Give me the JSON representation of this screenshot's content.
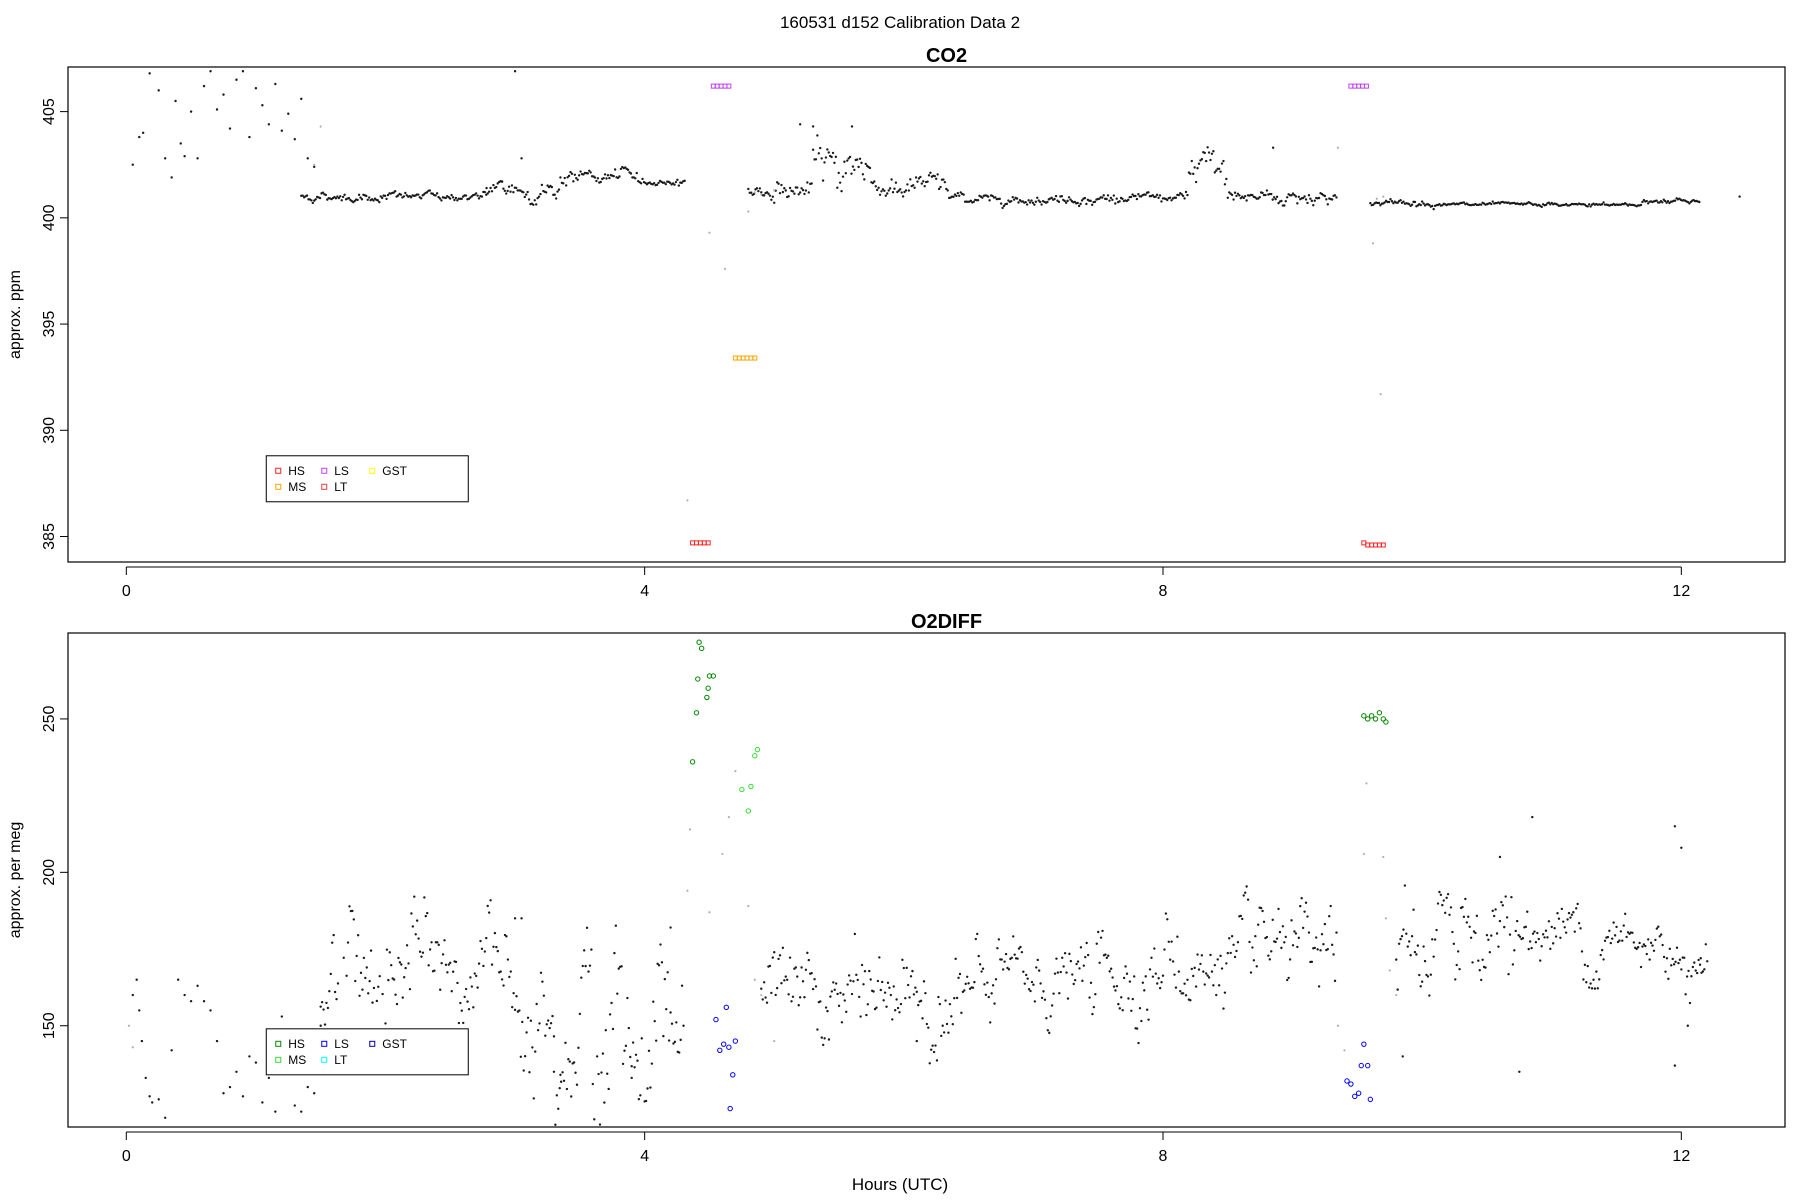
{
  "figure": {
    "suptitle": "160531   d152   Calibration Data 2",
    "xlabel": "Hours (UTC)"
  },
  "colors": {
    "data": "#1a1a1a",
    "data_gray": "#b0b0b0",
    "HS_co2": "#ff2020",
    "MS_co2": "#ffa500",
    "LS_co2": "#c040ff",
    "LT_co2": "#e04040",
    "GST_co2": "#ffff00",
    "HS_o2": "#008800",
    "MS_o2": "#33dd33",
    "LS_o2": "#0000ff",
    "LT_o2": "#00ffff",
    "GST_o2": "#0000aa"
  },
  "chart_data": [
    {
      "type": "scatter",
      "title": "CO2",
      "ylabel": "approx. ppm",
      "xlim": [
        -0.45,
        12.8
      ],
      "ylim": [
        383.8,
        407.1
      ],
      "x_ticks": [
        0,
        4,
        8,
        12
      ],
      "y_ticks": [
        385,
        390,
        395,
        400,
        405
      ],
      "grid": false,
      "legend": {
        "placement": "bottom-left",
        "entries": [
          {
            "label": "HS",
            "color_key": "HS_co2"
          },
          {
            "label": "LS",
            "color_key": "LS_co2"
          },
          {
            "label": "GST",
            "color_key": "GST_co2"
          },
          {
            "label": "MS",
            "color_key": "MS_co2"
          },
          {
            "label": "LT",
            "color_key": "LT_co2"
          }
        ]
      },
      "baseline_series": {
        "name": "data",
        "points": [
          [
            0.05,
            402.5
          ],
          [
            0.1,
            403.8
          ],
          [
            0.13,
            404.0
          ],
          [
            0.18,
            406.8
          ],
          [
            0.25,
            406.0
          ],
          [
            0.3,
            402.8
          ],
          [
            0.35,
            401.9
          ],
          [
            0.38,
            405.5
          ],
          [
            0.42,
            403.5
          ],
          [
            0.45,
            402.9
          ],
          [
            0.5,
            405.0
          ],
          [
            0.55,
            402.8
          ],
          [
            0.6,
            406.2
          ],
          [
            0.65,
            406.9
          ],
          [
            0.7,
            405.1
          ],
          [
            0.75,
            405.8
          ],
          [
            0.8,
            404.2
          ],
          [
            0.85,
            406.5
          ],
          [
            0.9,
            406.9
          ],
          [
            0.95,
            403.8
          ],
          [
            1.0,
            406.1
          ],
          [
            1.05,
            405.3
          ],
          [
            1.1,
            404.4
          ],
          [
            1.15,
            406.3
          ],
          [
            1.2,
            404.1
          ],
          [
            1.25,
            404.9
          ],
          [
            1.3,
            403.7
          ],
          [
            1.35,
            405.6
          ],
          [
            1.4,
            402.8
          ],
          [
            1.45,
            402.4
          ],
          [
            3.0,
            406.9
          ],
          [
            3.05,
            402.8
          ],
          [
            2.78,
            401.4
          ],
          [
            2.9,
            401.7
          ]
        ],
        "segments": [
          {
            "x0": 1.35,
            "x1": 2.8,
            "y": 401.0,
            "noise": 0.12
          },
          {
            "x0": 2.8,
            "x1": 3.35,
            "y": 401.3,
            "noise": 0.25
          },
          {
            "x0": 3.35,
            "x1": 3.95,
            "y": 401.9,
            "noise": 0.18
          },
          {
            "x0": 3.95,
            "x1": 4.32,
            "y": 401.7,
            "noise": 0.08
          },
          {
            "x0": 4.8,
            "x1": 5.3,
            "y": 401.3,
            "noise": 0.25
          },
          {
            "x0": 5.3,
            "x1": 5.75,
            "y": 402.5,
            "noise": 0.55
          },
          {
            "x0": 5.75,
            "x1": 6.35,
            "y": 401.5,
            "noise": 0.3
          },
          {
            "x0": 6.35,
            "x1": 8.2,
            "y": 400.9,
            "noise": 0.12
          },
          {
            "x0": 8.2,
            "x1": 8.5,
            "y": 402.2,
            "noise": 0.6
          },
          {
            "x0": 8.5,
            "x1": 9.35,
            "y": 401.0,
            "noise": 0.2
          },
          {
            "x0": 9.6,
            "x1": 10.1,
            "y": 400.7,
            "noise": 0.08
          },
          {
            "x0": 10.1,
            "x1": 11.7,
            "y": 400.6,
            "noise": 0.05
          },
          {
            "x0": 11.7,
            "x1": 12.15,
            "y": 400.8,
            "noise": 0.08
          }
        ],
        "extra": [
          [
            12.45,
            401.0
          ],
          [
            5.2,
            404.4
          ],
          [
            5.3,
            404.3
          ],
          [
            5.6,
            404.3
          ],
          [
            8.85,
            403.3
          ]
        ]
      },
      "transition_points": [
        [
          4.33,
          386.7
        ],
        [
          4.5,
          399.3
        ],
        [
          4.62,
          397.6
        ],
        [
          4.8,
          400.3
        ],
        [
          4.85,
          401.2
        ],
        [
          4.9,
          401.1
        ],
        [
          5.0,
          401.3
        ],
        [
          9.35,
          403.3
        ],
        [
          9.62,
          398.8
        ],
        [
          9.68,
          391.7
        ],
        [
          9.65,
          400.9
        ],
        [
          9.7,
          401.0
        ],
        [
          1.45,
          402.5
        ],
        [
          1.5,
          404.3
        ]
      ],
      "cal_series": [
        {
          "name": "HS",
          "color_key": "HS_co2",
          "points": [
            [
              4.37,
              384.7
            ],
            [
              4.4,
              384.7
            ],
            [
              4.43,
              384.7
            ],
            [
              4.46,
              384.7
            ],
            [
              4.49,
              384.7
            ],
            [
              9.55,
              384.7
            ],
            [
              9.58,
              384.6
            ],
            [
              9.61,
              384.6
            ],
            [
              9.64,
              384.6
            ],
            [
              9.67,
              384.6
            ],
            [
              9.7,
              384.6
            ]
          ]
        },
        {
          "name": "LS",
          "color_key": "LS_co2",
          "points": [
            [
              4.53,
              406.2
            ],
            [
              4.56,
              406.2
            ],
            [
              4.59,
              406.2
            ],
            [
              4.62,
              406.2
            ],
            [
              4.65,
              406.2
            ],
            [
              9.45,
              406.2
            ],
            [
              9.48,
              406.2
            ],
            [
              9.51,
              406.2
            ],
            [
              9.54,
              406.2
            ],
            [
              9.57,
              406.2
            ]
          ]
        },
        {
          "name": "MS",
          "color_key": "MS_co2",
          "points": [
            [
              4.7,
              393.4
            ],
            [
              4.73,
              393.4
            ],
            [
              4.76,
              393.4
            ],
            [
              4.79,
              393.4
            ],
            [
              4.82,
              393.4
            ],
            [
              4.85,
              393.4
            ]
          ]
        }
      ]
    },
    {
      "type": "scatter",
      "title": "O2DIFF",
      "ylabel": "approx. per meg",
      "xlim": [
        -0.45,
        12.8
      ],
      "ylim": [
        117,
        278
      ],
      "x_ticks": [
        0,
        4,
        8,
        12
      ],
      "y_ticks": [
        150,
        200,
        250
      ],
      "grid": false,
      "legend": {
        "placement": "bottom-left",
        "entries": [
          {
            "label": "HS",
            "color_key": "HS_o2"
          },
          {
            "label": "LS",
            "color_key": "LS_o2"
          },
          {
            "label": "GST",
            "color_key": "GST_o2"
          },
          {
            "label": "MS",
            "color_key": "MS_o2"
          },
          {
            "label": "LT",
            "color_key": "LT_o2"
          }
        ]
      },
      "baseline_series": {
        "name": "data",
        "points": [
          [
            0.05,
            160
          ],
          [
            0.08,
            165
          ],
          [
            0.1,
            155
          ],
          [
            0.12,
            145
          ],
          [
            0.15,
            133
          ],
          [
            0.18,
            127
          ],
          [
            0.2,
            125
          ],
          [
            0.25,
            126
          ],
          [
            0.3,
            120
          ],
          [
            0.35,
            142
          ],
          [
            0.4,
            165
          ],
          [
            0.45,
            160
          ],
          [
            0.5,
            158
          ],
          [
            0.55,
            163
          ],
          [
            0.6,
            158
          ],
          [
            0.65,
            155
          ],
          [
            0.7,
            145
          ],
          [
            0.75,
            128
          ],
          [
            0.8,
            130
          ],
          [
            0.85,
            135
          ],
          [
            0.9,
            127
          ],
          [
            0.95,
            140
          ],
          [
            1.0,
            138
          ],
          [
            1.05,
            125
          ],
          [
            1.1,
            133
          ],
          [
            1.15,
            122
          ],
          [
            1.2,
            153
          ],
          [
            1.25,
            148
          ],
          [
            1.3,
            124
          ],
          [
            1.35,
            122
          ],
          [
            1.4,
            130
          ],
          [
            1.45,
            128
          ],
          [
            1.5,
            150
          ],
          [
            3.0,
            185
          ],
          [
            3.05,
            185
          ],
          [
            3.3,
            135
          ],
          [
            3.35,
            134
          ],
          [
            4.2,
            182
          ],
          [
            4.3,
            150
          ],
          [
            10.85,
            218
          ],
          [
            10.6,
            205
          ],
          [
            11.95,
            215
          ],
          [
            12.0,
            208
          ],
          [
            11.95,
            137
          ],
          [
            12.05,
            150
          ],
          [
            10.75,
            135
          ],
          [
            9.85,
            140
          ]
        ],
        "segments": [
          {
            "x0": 1.5,
            "x1": 2.0,
            "y": 165,
            "noise": 12
          },
          {
            "x0": 2.0,
            "x1": 3.0,
            "y": 168,
            "noise": 10
          },
          {
            "x0": 3.0,
            "x1": 3.6,
            "y": 160,
            "noise": 12
          },
          {
            "x0": 3.6,
            "x1": 4.1,
            "y": 148,
            "noise": 14
          },
          {
            "x0": 4.1,
            "x1": 4.3,
            "y": 160,
            "noise": 12
          },
          {
            "x0": 4.9,
            "x1": 5.6,
            "y": 158,
            "noise": 8
          },
          {
            "x0": 5.6,
            "x1": 6.6,
            "y": 160,
            "noise": 8
          },
          {
            "x0": 6.6,
            "x1": 7.6,
            "y": 165,
            "noise": 7
          },
          {
            "x0": 7.6,
            "x1": 8.5,
            "y": 168,
            "noise": 8
          },
          {
            "x0": 8.5,
            "x1": 9.35,
            "y": 170,
            "noise": 7
          },
          {
            "x0": 9.8,
            "x1": 10.3,
            "y": 175,
            "noise": 10
          },
          {
            "x0": 10.3,
            "x1": 10.7,
            "y": 183,
            "noise": 8
          },
          {
            "x0": 10.7,
            "x1": 11.4,
            "y": 180,
            "noise": 6
          },
          {
            "x0": 11.4,
            "x1": 12.2,
            "y": 175,
            "noise": 6
          }
        ],
        "extra": [
          [
            12.15,
            172
          ],
          [
            12.2,
            171
          ],
          [
            6.1,
            145
          ],
          [
            3.9,
            133
          ]
        ]
      },
      "transition_points": [
        [
          4.33,
          194
        ],
        [
          4.35,
          214
        ],
        [
          4.5,
          187
        ],
        [
          4.6,
          206
        ],
        [
          4.65,
          218
        ],
        [
          4.7,
          233
        ],
        [
          4.8,
          189
        ],
        [
          4.85,
          165
        ],
        [
          4.9,
          160
        ],
        [
          5.0,
          145
        ],
        [
          9.35,
          150
        ],
        [
          9.4,
          142
        ],
        [
          9.55,
          206
        ],
        [
          9.57,
          229
        ],
        [
          9.7,
          205
        ],
        [
          9.72,
          185
        ],
        [
          9.75,
          168
        ],
        [
          9.8,
          160
        ],
        [
          0.02,
          150
        ],
        [
          0.05,
          143
        ]
      ],
      "cal_series": [
        {
          "name": "HS",
          "color_key": "HS_o2",
          "points": [
            [
              4.37,
              236
            ],
            [
              4.4,
              252
            ],
            [
              4.41,
              263
            ],
            [
              4.42,
              275
            ],
            [
              4.44,
              273
            ],
            [
              4.48,
              257
            ],
            [
              4.49,
              260
            ],
            [
              4.5,
              264
            ],
            [
              4.53,
              264
            ],
            [
              9.55,
              251
            ],
            [
              9.58,
              250
            ],
            [
              9.61,
              251
            ],
            [
              9.64,
              250
            ],
            [
              9.67,
              252
            ],
            [
              9.7,
              250
            ],
            [
              9.72,
              249
            ]
          ]
        },
        {
          "name": "LS",
          "color_key": "LS_o2",
          "points": [
            [
              4.55,
              152
            ],
            [
              4.58,
              142
            ],
            [
              4.61,
              144
            ],
            [
              4.63,
              156
            ],
            [
              4.65,
              143
            ],
            [
              4.68,
              134
            ],
            [
              4.7,
              145
            ],
            [
              4.66,
              123
            ],
            [
              9.42,
              132
            ],
            [
              9.45,
              131
            ],
            [
              9.48,
              127
            ],
            [
              9.51,
              128
            ],
            [
              9.53,
              137
            ],
            [
              9.55,
              144
            ],
            [
              9.58,
              137
            ],
            [
              9.6,
              126
            ]
          ]
        },
        {
          "name": "MS",
          "color_key": "MS_o2",
          "points": [
            [
              4.75,
              227
            ],
            [
              4.8,
              220
            ],
            [
              4.82,
              228
            ],
            [
              4.85,
              238
            ],
            [
              4.87,
              240
            ]
          ]
        }
      ]
    }
  ]
}
